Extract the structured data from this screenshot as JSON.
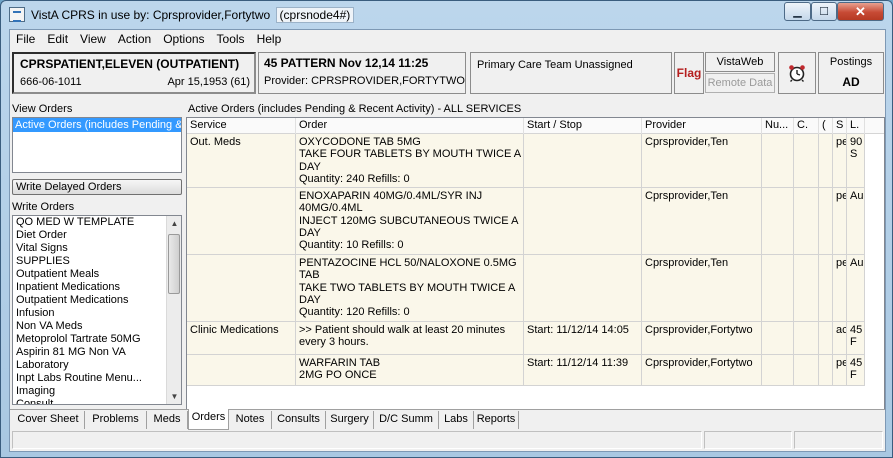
{
  "window": {
    "title": "VistA CPRS in use by: Cprsprovider,Fortytwo",
    "node": "(cprsnode4#)",
    "min_glyph": "▁",
    "max_glyph": "☐",
    "close_glyph": "✕"
  },
  "menu": [
    "File",
    "Edit",
    "View",
    "Action",
    "Options",
    "Tools",
    "Help"
  ],
  "patient": {
    "name": "CPRSPATIENT,ELEVEN (OUTPATIENT)",
    "ssn": "666-06-1011",
    "dob": "Apr 15,1953 (61)"
  },
  "encounter": {
    "location": "45 PATTERN Nov 12,14 11:25",
    "provider": "Provider:  CPRSPROVIDER,FORTYTWO"
  },
  "pcp": "Primary Care Team Unassigned",
  "flag": "Flag",
  "vistaweb": "VistaWeb",
  "remote_data": "Remote Data",
  "postings": {
    "label": "Postings",
    "value": "AD"
  },
  "left": {
    "view_orders_label": "View Orders",
    "view_selected": "Active Orders (includes Pending & Recent Activity) - ALL SERVICES",
    "write_delayed": "Write Delayed Orders",
    "write_orders_label": "Write Orders",
    "write_items": [
      "QO MED W TEMPLATE",
      "Diet Order",
      "Vital Signs",
      "SUPPLIES",
      "Outpatient Meals",
      "Inpatient Medications",
      "Outpatient Medications",
      "Infusion",
      "Non VA Meds",
      "Metoprolol Tartrate 50MG",
      "Aspirin 81 MG Non VA",
      "Laboratory",
      "Inpt Labs Routine Menu...",
      "Imaging",
      "Consult"
    ]
  },
  "orders": {
    "caption": "Active Orders (includes Pending & Recent Activity) - ALL SERVICES",
    "columns": [
      "Service",
      "Order",
      "Start / Stop",
      "Provider",
      "Nu...",
      "C.",
      "(",
      "S",
      "L."
    ],
    "rows": [
      {
        "service": "Out. Meds",
        "order": [
          "OXYCODONE TAB 5MG",
          "TAKE FOUR TABLETS BY MOUTH TWICE A",
          "DAY",
          "Quantity: 240 Refills: 0"
        ],
        "start": "",
        "provider": "Cprsprovider,Ten",
        "status": "pe",
        "loc": "90 S"
      },
      {
        "service": "",
        "order": [
          "ENOXAPARIN 40MG/0.4ML/SYR INJ",
          "40MG/0.4ML",
          "INJECT 120MG SUBCUTANEOUS TWICE A",
          "DAY",
          "Quantity: 10 Refills: 0"
        ],
        "start": "",
        "provider": "Cprsprovider,Ten",
        "status": "pe",
        "loc": "Aud"
      },
      {
        "service": "",
        "order": [
          "PENTAZOCINE HCL 50/NALOXONE 0.5MG",
          "TAB",
          "TAKE TWO TABLETS BY MOUTH TWICE A",
          "DAY",
          "Quantity: 120 Refills: 0"
        ],
        "start": "",
        "provider": "Cprsprovider,Ten",
        "status": "pe",
        "loc": "Aud"
      },
      {
        "service": "Clinic Medications",
        "order": [
          ">> Patient should walk at least 20 minutes",
          "every 3 hours."
        ],
        "start": "Start: 11/12/14 14:05",
        "provider": "Cprsprovider,Fortytwo",
        "status": "ac",
        "loc": "45 F"
      },
      {
        "service": "",
        "order": [
          "WARFARIN TAB",
          "2MG PO ONCE"
        ],
        "start": "Start: 11/12/14 11:39",
        "provider": "Cprsprovider,Fortytwo",
        "status": "pe",
        "loc": "45 F"
      }
    ]
  },
  "tabs": [
    "Cover Sheet",
    "Problems",
    "Meds",
    "Orders",
    "Notes",
    "Consults",
    "Surgery",
    "D/C Summ",
    "Labs",
    "Reports"
  ],
  "active_tab": "Orders"
}
